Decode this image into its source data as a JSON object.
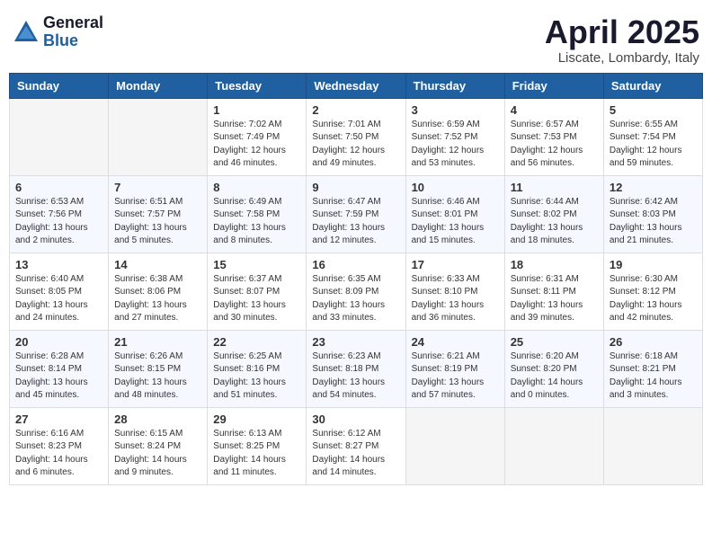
{
  "header": {
    "logo_general": "General",
    "logo_blue": "Blue",
    "month": "April 2025",
    "location": "Liscate, Lombardy, Italy"
  },
  "weekdays": [
    "Sunday",
    "Monday",
    "Tuesday",
    "Wednesday",
    "Thursday",
    "Friday",
    "Saturday"
  ],
  "weeks": [
    [
      {
        "day": "",
        "info": ""
      },
      {
        "day": "",
        "info": ""
      },
      {
        "day": "1",
        "info": "Sunrise: 7:02 AM\nSunset: 7:49 PM\nDaylight: 12 hours and 46 minutes."
      },
      {
        "day": "2",
        "info": "Sunrise: 7:01 AM\nSunset: 7:50 PM\nDaylight: 12 hours and 49 minutes."
      },
      {
        "day": "3",
        "info": "Sunrise: 6:59 AM\nSunset: 7:52 PM\nDaylight: 12 hours and 53 minutes."
      },
      {
        "day": "4",
        "info": "Sunrise: 6:57 AM\nSunset: 7:53 PM\nDaylight: 12 hours and 56 minutes."
      },
      {
        "day": "5",
        "info": "Sunrise: 6:55 AM\nSunset: 7:54 PM\nDaylight: 12 hours and 59 minutes."
      }
    ],
    [
      {
        "day": "6",
        "info": "Sunrise: 6:53 AM\nSunset: 7:56 PM\nDaylight: 13 hours and 2 minutes."
      },
      {
        "day": "7",
        "info": "Sunrise: 6:51 AM\nSunset: 7:57 PM\nDaylight: 13 hours and 5 minutes."
      },
      {
        "day": "8",
        "info": "Sunrise: 6:49 AM\nSunset: 7:58 PM\nDaylight: 13 hours and 8 minutes."
      },
      {
        "day": "9",
        "info": "Sunrise: 6:47 AM\nSunset: 7:59 PM\nDaylight: 13 hours and 12 minutes."
      },
      {
        "day": "10",
        "info": "Sunrise: 6:46 AM\nSunset: 8:01 PM\nDaylight: 13 hours and 15 minutes."
      },
      {
        "day": "11",
        "info": "Sunrise: 6:44 AM\nSunset: 8:02 PM\nDaylight: 13 hours and 18 minutes."
      },
      {
        "day": "12",
        "info": "Sunrise: 6:42 AM\nSunset: 8:03 PM\nDaylight: 13 hours and 21 minutes."
      }
    ],
    [
      {
        "day": "13",
        "info": "Sunrise: 6:40 AM\nSunset: 8:05 PM\nDaylight: 13 hours and 24 minutes."
      },
      {
        "day": "14",
        "info": "Sunrise: 6:38 AM\nSunset: 8:06 PM\nDaylight: 13 hours and 27 minutes."
      },
      {
        "day": "15",
        "info": "Sunrise: 6:37 AM\nSunset: 8:07 PM\nDaylight: 13 hours and 30 minutes."
      },
      {
        "day": "16",
        "info": "Sunrise: 6:35 AM\nSunset: 8:09 PM\nDaylight: 13 hours and 33 minutes."
      },
      {
        "day": "17",
        "info": "Sunrise: 6:33 AM\nSunset: 8:10 PM\nDaylight: 13 hours and 36 minutes."
      },
      {
        "day": "18",
        "info": "Sunrise: 6:31 AM\nSunset: 8:11 PM\nDaylight: 13 hours and 39 minutes."
      },
      {
        "day": "19",
        "info": "Sunrise: 6:30 AM\nSunset: 8:12 PM\nDaylight: 13 hours and 42 minutes."
      }
    ],
    [
      {
        "day": "20",
        "info": "Sunrise: 6:28 AM\nSunset: 8:14 PM\nDaylight: 13 hours and 45 minutes."
      },
      {
        "day": "21",
        "info": "Sunrise: 6:26 AM\nSunset: 8:15 PM\nDaylight: 13 hours and 48 minutes."
      },
      {
        "day": "22",
        "info": "Sunrise: 6:25 AM\nSunset: 8:16 PM\nDaylight: 13 hours and 51 minutes."
      },
      {
        "day": "23",
        "info": "Sunrise: 6:23 AM\nSunset: 8:18 PM\nDaylight: 13 hours and 54 minutes."
      },
      {
        "day": "24",
        "info": "Sunrise: 6:21 AM\nSunset: 8:19 PM\nDaylight: 13 hours and 57 minutes."
      },
      {
        "day": "25",
        "info": "Sunrise: 6:20 AM\nSunset: 8:20 PM\nDaylight: 14 hours and 0 minutes."
      },
      {
        "day": "26",
        "info": "Sunrise: 6:18 AM\nSunset: 8:21 PM\nDaylight: 14 hours and 3 minutes."
      }
    ],
    [
      {
        "day": "27",
        "info": "Sunrise: 6:16 AM\nSunset: 8:23 PM\nDaylight: 14 hours and 6 minutes."
      },
      {
        "day": "28",
        "info": "Sunrise: 6:15 AM\nSunset: 8:24 PM\nDaylight: 14 hours and 9 minutes."
      },
      {
        "day": "29",
        "info": "Sunrise: 6:13 AM\nSunset: 8:25 PM\nDaylight: 14 hours and 11 minutes."
      },
      {
        "day": "30",
        "info": "Sunrise: 6:12 AM\nSunset: 8:27 PM\nDaylight: 14 hours and 14 minutes."
      },
      {
        "day": "",
        "info": ""
      },
      {
        "day": "",
        "info": ""
      },
      {
        "day": "",
        "info": ""
      }
    ]
  ]
}
